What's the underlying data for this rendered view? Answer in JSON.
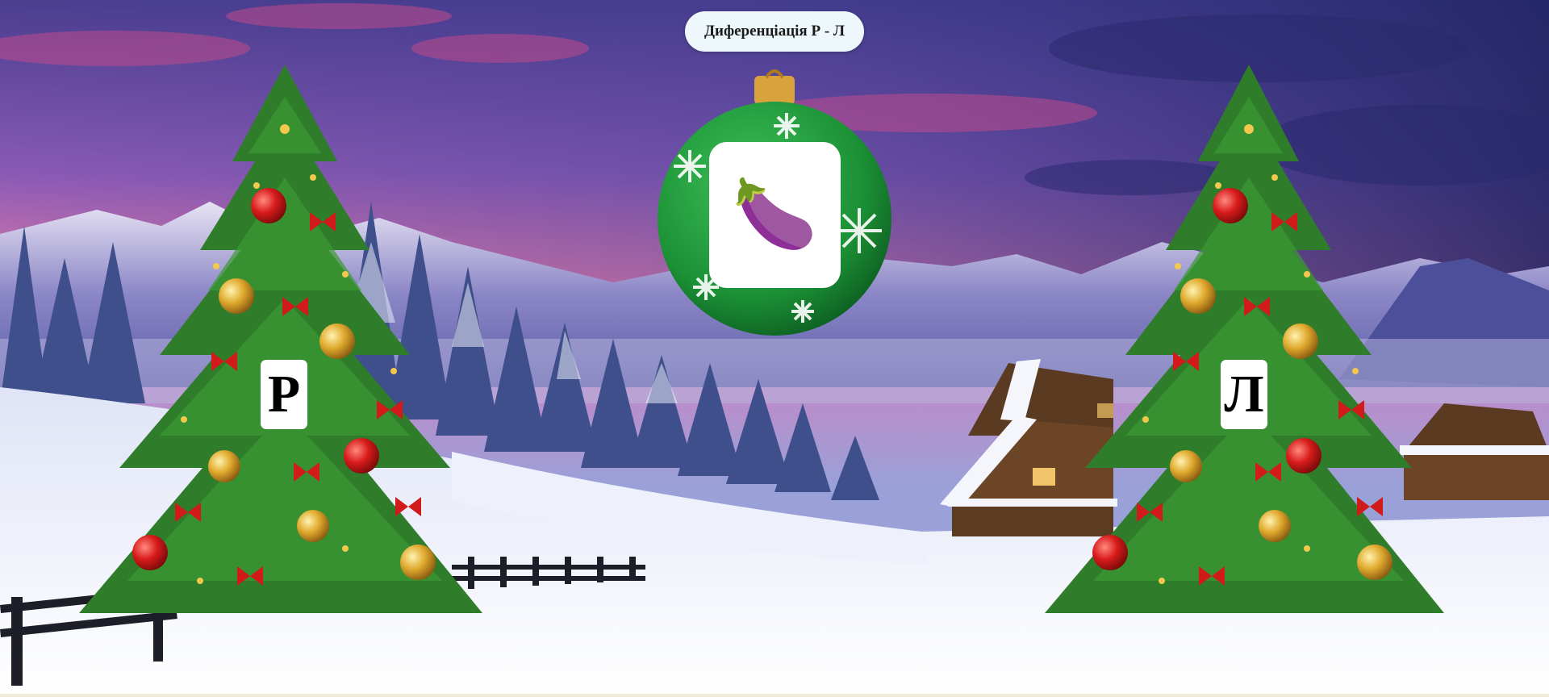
{
  "game": {
    "title": "Диференціація Р - Л",
    "current_item": {
      "icon": "eggplant-icon",
      "emoji": "🍆"
    },
    "targets": [
      {
        "letter": "Р"
      },
      {
        "letter": "Л"
      }
    ]
  },
  "colors": {
    "ornament_green": "#1f9a3a",
    "ornament_cap": "#d8a23c",
    "tree_green": "#2d7a2a",
    "sky_purple": "#6e4fb0",
    "sky_pink": "#e87aa6",
    "snow": "#f3f6fc"
  }
}
